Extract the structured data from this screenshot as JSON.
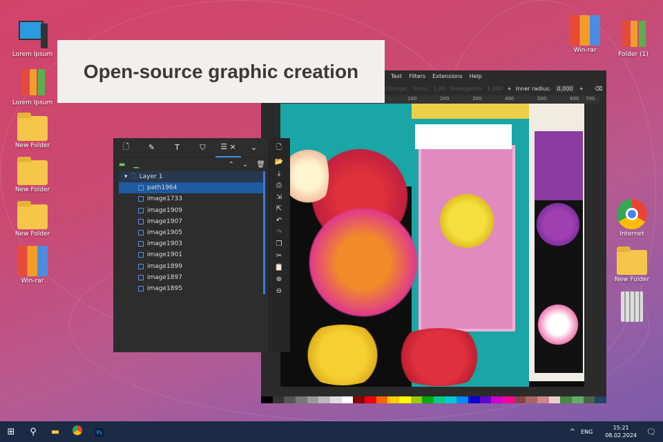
{
  "banner": {
    "title": "Open-source graphic creation"
  },
  "desktop_left": [
    {
      "label": "Lorem Ipsum",
      "icon": "computer-icon"
    },
    {
      "label": "Lorem Ipsum",
      "icon": "binders-icon"
    },
    {
      "label": "New Folder",
      "icon": "folder-icon"
    },
    {
      "label": "New Folder",
      "icon": "folder-icon"
    },
    {
      "label": "New Folder",
      "icon": "folder-icon"
    },
    {
      "label": "Win-rar",
      "icon": "winrar-icon"
    }
  ],
  "desktop_right": [
    {
      "label": "Win-rar",
      "icon": "winrar-icon"
    },
    {
      "label": "Folder (1)",
      "icon": "binders-icon"
    },
    {
      "label": "Internet",
      "icon": "chrome-icon"
    },
    {
      "label": "New Folder",
      "icon": "folder-icon"
    },
    {
      "label": "",
      "icon": "recycle-bin-icon"
    }
  ],
  "inkscape": {
    "menu": [
      "Text",
      "Filters",
      "Extensions",
      "Help"
    ],
    "toolbar": {
      "change": "Change:",
      "turns_label": "Turns:",
      "turns": "3,00",
      "divergence_label": "Divergence:",
      "divergence": "1,000",
      "inner_radius_label": "Inner radius:",
      "inner_radius": "0,000"
    },
    "ruler": [
      "100",
      "200",
      "300",
      "400",
      "500",
      "600",
      "700"
    ],
    "palette": [
      "#000",
      "#333",
      "#555",
      "#777",
      "#999",
      "#bbb",
      "#ddd",
      "#fff",
      "#800",
      "#e00",
      "#f60",
      "#fc0",
      "#ff0",
      "#9c0",
      "#0a0",
      "#0c8",
      "#0cc",
      "#08f",
      "#00c",
      "#60c",
      "#c0c",
      "#f09",
      "#844",
      "#a66",
      "#c88",
      "#ecc",
      "#484",
      "#6a6",
      "#464",
      "#246"
    ]
  },
  "layers_panel": {
    "tabs": [
      "document-icon",
      "pen-icon",
      "text-icon",
      "shield-icon",
      "layers-icon"
    ],
    "layer": "Layer 1",
    "items": [
      "path1964",
      "image1733",
      "image1909",
      "image1907",
      "image1905",
      "image1903",
      "image1901",
      "image1899",
      "image1897",
      "image1895"
    ],
    "selected": "path1964"
  },
  "taskbar": {
    "time": "15:21",
    "date": "08.02.2024",
    "lang": "ENG"
  },
  "colors": {
    "accent": "#1f5aa0",
    "taskbar": "#1b2b45"
  }
}
